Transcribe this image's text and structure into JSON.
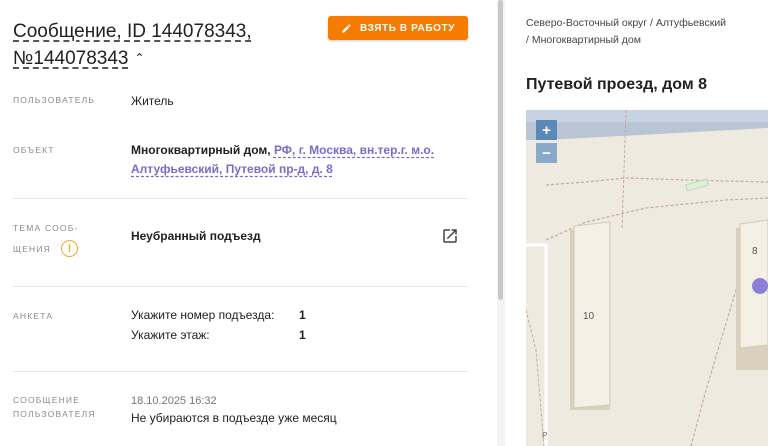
{
  "header": {
    "title": "Сообщение, ID 144078343, №144078343",
    "take_button_label": "ВЗЯТЬ В РАБОТУ"
  },
  "fields": {
    "user": {
      "label": "ПОЛЬЗОВАТЕЛЬ",
      "value": "Житель"
    },
    "object": {
      "label": "ОБЪЕКТ",
      "type": "Многоквартирный дом,",
      "address_link": "РФ, г. Москва, вн.тер.г. м.о. Алтуфьевский, Путевой пр-д, д. 8"
    },
    "topic": {
      "label_line1": "ТЕМА СООБ-",
      "label_line2": "ЩЕНИЯ",
      "value": "Неубранный подъезд"
    },
    "survey": {
      "label": "АНКЕТА",
      "items": [
        {
          "question": "Укажите номер подъезда:",
          "answer": "1"
        },
        {
          "question": "Укажите этаж:",
          "answer": "1"
        }
      ]
    },
    "message": {
      "label_line1": "СООБЩЕНИЕ",
      "label_line2": "ПОЛЬЗОВАТЕЛЯ",
      "date": "18.10.2025 16:32",
      "text": "Не убираются в подъезде уже месяц"
    }
  },
  "location": {
    "breadcrumb_line1": "Северо-Восточный округ / Алтуфьевский",
    "breadcrumb_line2": "/ Многоквартирный дом",
    "address": "Путевой проезд, дом 8",
    "map": {
      "zoom_in": "+",
      "zoom_out": "−",
      "building_10": "10",
      "building_8": "8",
      "parking_label": "P",
      "accent_color": "#8d7fd6"
    }
  },
  "colors": {
    "primary_button": "#f57c00",
    "link": "#7b6cc8",
    "warning": "#f5a623"
  }
}
